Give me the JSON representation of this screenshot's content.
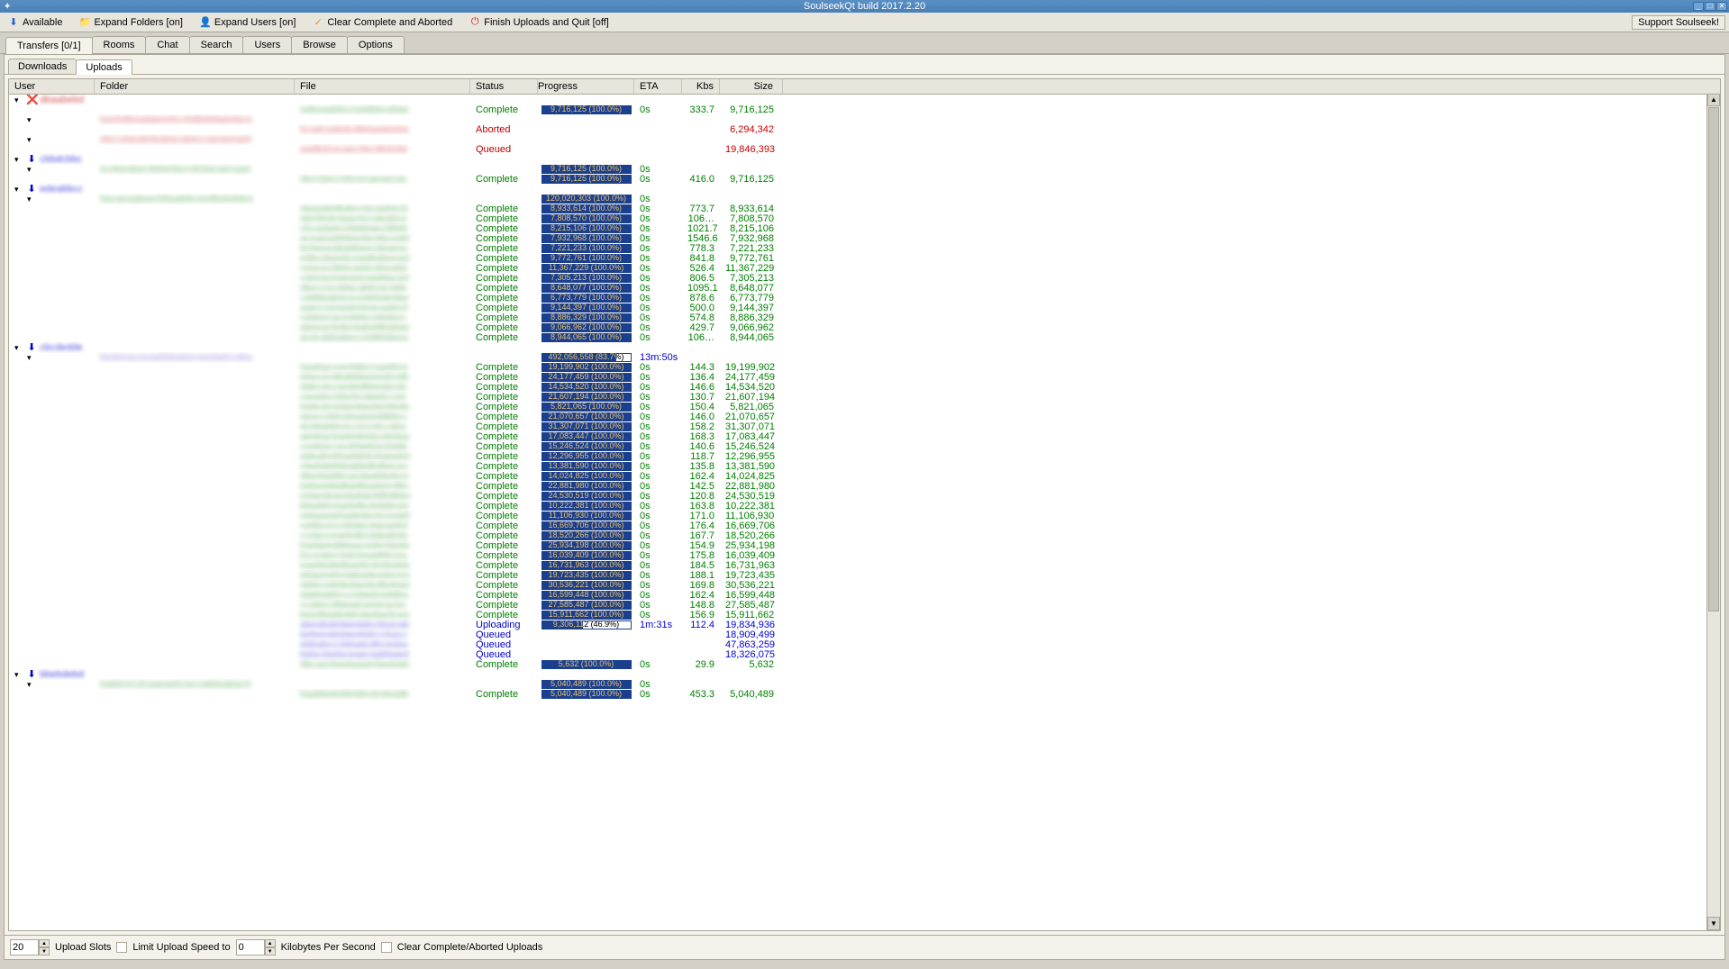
{
  "titlebar": {
    "title": "SoulseekQt build 2017.2.20"
  },
  "toolbar": {
    "available": "Available",
    "expand_folders": "Expand Folders [on]",
    "expand_users": "Expand Users [on]",
    "clear": "Clear Complete and Aborted",
    "finish": "Finish Uploads and Quit [off]",
    "support": "Support Soulseek!"
  },
  "tabs": {
    "main": [
      "Transfers [0/1]",
      "Rooms",
      "Chat",
      "Search",
      "Users",
      "Browse",
      "Options"
    ],
    "sub": [
      "Downloads",
      "Uploads"
    ]
  },
  "headers": {
    "user": "User",
    "folder": "Folder",
    "file": "File",
    "status": "Status",
    "progress": "Progress",
    "eta": "ETA",
    "kbs": "Kbs",
    "size": "Size"
  },
  "status_labels": {
    "complete": "Complete",
    "aborted": "Aborted",
    "queued": "Queued",
    "uploading": "Uploading"
  },
  "rows": [
    {
      "t": "user",
      "usercls": "red",
      "icon": "❌"
    },
    {
      "t": "file",
      "status": "complete",
      "progress": "9,716,125 (100.0%)",
      "pct": 100,
      "eta": "0s",
      "kbs": "333.7",
      "size": "9,716,125",
      "cls": "green"
    },
    {
      "t": "folder",
      "cls": "red"
    },
    {
      "t": "file",
      "status": "aborted",
      "size": "6,294,342",
      "cls": "red"
    },
    {
      "t": "folder",
      "cls": "red"
    },
    {
      "t": "file",
      "status": "queued",
      "size": "19,846,393",
      "cls": "red"
    },
    {
      "t": "user",
      "usercls": "blue",
      "icon": "⬇"
    },
    {
      "t": "folder",
      "progress": "9,716,125 (100.0%)",
      "pct": 100,
      "eta": "0s",
      "cls": "green"
    },
    {
      "t": "file",
      "status": "complete",
      "progress": "9,716,125 (100.0%)",
      "pct": 100,
      "eta": "0s",
      "kbs": "416.0",
      "size": "9,716,125",
      "cls": "green"
    },
    {
      "t": "user",
      "usercls": "blue",
      "icon": "⬇"
    },
    {
      "t": "folder",
      "progress": "120,020,303 (100.0%)",
      "pct": 100,
      "eta": "0s",
      "cls": "green"
    },
    {
      "t": "file",
      "status": "complete",
      "progress": "8,933,614 (100.0%)",
      "pct": 100,
      "eta": "0s",
      "kbs": "773.7",
      "size": "8,933,614",
      "cls": "green"
    },
    {
      "t": "file",
      "status": "complete",
      "progress": "7,808,570 (100.0%)",
      "pct": 100,
      "eta": "0s",
      "kbs": "106…",
      "size": "7,808,570",
      "cls": "green"
    },
    {
      "t": "file",
      "status": "complete",
      "progress": "8,215,106 (100.0%)",
      "pct": 100,
      "eta": "0s",
      "kbs": "1021.7",
      "size": "8,215,106",
      "cls": "green"
    },
    {
      "t": "file",
      "status": "complete",
      "progress": "7,932,968 (100.0%)",
      "pct": 100,
      "eta": "0s",
      "kbs": "1546.6",
      "size": "7,932,968",
      "cls": "green"
    },
    {
      "t": "file",
      "status": "complete",
      "progress": "7,221,233 (100.0%)",
      "pct": 100,
      "eta": "0s",
      "kbs": "778.3",
      "size": "7,221,233",
      "cls": "green"
    },
    {
      "t": "file",
      "status": "complete",
      "progress": "9,772,761 (100.0%)",
      "pct": 100,
      "eta": "0s",
      "kbs": "841.8",
      "size": "9,772,761",
      "cls": "green"
    },
    {
      "t": "file",
      "status": "complete",
      "progress": "11,367,229 (100.0%)",
      "pct": 100,
      "eta": "0s",
      "kbs": "526.4",
      "size": "11,367,229",
      "cls": "green"
    },
    {
      "t": "file",
      "status": "complete",
      "progress": "7,305,213 (100.0%)",
      "pct": 100,
      "eta": "0s",
      "kbs": "806.5",
      "size": "7,305,213",
      "cls": "green"
    },
    {
      "t": "file",
      "status": "complete",
      "progress": "8,648,077 (100.0%)",
      "pct": 100,
      "eta": "0s",
      "kbs": "1095.1",
      "size": "8,648,077",
      "cls": "green"
    },
    {
      "t": "file",
      "status": "complete",
      "progress": "6,773,779 (100.0%)",
      "pct": 100,
      "eta": "0s",
      "kbs": "878.6",
      "size": "6,773,779",
      "cls": "green"
    },
    {
      "t": "file",
      "status": "complete",
      "progress": "9,144,397 (100.0%)",
      "pct": 100,
      "eta": "0s",
      "kbs": "500.0",
      "size": "9,144,397",
      "cls": "green"
    },
    {
      "t": "file",
      "status": "complete",
      "progress": "8,886,329 (100.0%)",
      "pct": 100,
      "eta": "0s",
      "kbs": "574.8",
      "size": "8,886,329",
      "cls": "green"
    },
    {
      "t": "file",
      "status": "complete",
      "progress": "9,066,962 (100.0%)",
      "pct": 100,
      "eta": "0s",
      "kbs": "429.7",
      "size": "9,066,962",
      "cls": "green"
    },
    {
      "t": "file",
      "status": "complete",
      "progress": "8,944,065 (100.0%)",
      "pct": 100,
      "eta": "0s",
      "kbs": "106…",
      "size": "8,944,065",
      "cls": "green"
    },
    {
      "t": "user",
      "usercls": "blue",
      "icon": "⬇"
    },
    {
      "t": "folder",
      "progress": "492,056,558 (83.7%)",
      "pct": 83.7,
      "eta": "13m:50s",
      "cls": "blue",
      "foldercls": "purple"
    },
    {
      "t": "file",
      "status": "complete",
      "progress": "19,199,902 (100.0%)",
      "pct": 100,
      "eta": "0s",
      "kbs": "144.3",
      "size": "19,199,902",
      "cls": "green"
    },
    {
      "t": "file",
      "status": "complete",
      "progress": "24,177,459 (100.0%)",
      "pct": 100,
      "eta": "0s",
      "kbs": "136.4",
      "size": "24,177,459",
      "cls": "green"
    },
    {
      "t": "file",
      "status": "complete",
      "progress": "14,534,520 (100.0%)",
      "pct": 100,
      "eta": "0s",
      "kbs": "146.6",
      "size": "14,534,520",
      "cls": "green"
    },
    {
      "t": "file",
      "status": "complete",
      "progress": "21,607,194 (100.0%)",
      "pct": 100,
      "eta": "0s",
      "kbs": "130.7",
      "size": "21,607,194",
      "cls": "green"
    },
    {
      "t": "file",
      "status": "complete",
      "progress": "5,821,065 (100.0%)",
      "pct": 100,
      "eta": "0s",
      "kbs": "150.4",
      "size": "5,821,065",
      "cls": "green"
    },
    {
      "t": "file",
      "status": "complete",
      "progress": "21,070,657 (100.0%)",
      "pct": 100,
      "eta": "0s",
      "kbs": "146.0",
      "size": "21,070,657",
      "cls": "green"
    },
    {
      "t": "file",
      "status": "complete",
      "progress": "31,307,071 (100.0%)",
      "pct": 100,
      "eta": "0s",
      "kbs": "158.2",
      "size": "31,307,071",
      "cls": "green"
    },
    {
      "t": "file",
      "status": "complete",
      "progress": "17,083,447 (100.0%)",
      "pct": 100,
      "eta": "0s",
      "kbs": "168.3",
      "size": "17,083,447",
      "cls": "green"
    },
    {
      "t": "file",
      "status": "complete",
      "progress": "15,246,524 (100.0%)",
      "pct": 100,
      "eta": "0s",
      "kbs": "140.6",
      "size": "15,246,524",
      "cls": "green"
    },
    {
      "t": "file",
      "status": "complete",
      "progress": "12,296,955 (100.0%)",
      "pct": 100,
      "eta": "0s",
      "kbs": "118.7",
      "size": "12,296,955",
      "cls": "green"
    },
    {
      "t": "file",
      "status": "complete",
      "progress": "13,381,590 (100.0%)",
      "pct": 100,
      "eta": "0s",
      "kbs": "135.8",
      "size": "13,381,590",
      "cls": "green"
    },
    {
      "t": "file",
      "status": "complete",
      "progress": "14,024,825 (100.0%)",
      "pct": 100,
      "eta": "0s",
      "kbs": "162.4",
      "size": "14,024,825",
      "cls": "green"
    },
    {
      "t": "file",
      "status": "complete",
      "progress": "22,881,980 (100.0%)",
      "pct": 100,
      "eta": "0s",
      "kbs": "142.5",
      "size": "22,881,980",
      "cls": "green"
    },
    {
      "t": "file",
      "status": "complete",
      "progress": "24,530,519 (100.0%)",
      "pct": 100,
      "eta": "0s",
      "kbs": "120.8",
      "size": "24,530,519",
      "cls": "green"
    },
    {
      "t": "file",
      "status": "complete",
      "progress": "10,222,381 (100.0%)",
      "pct": 100,
      "eta": "0s",
      "kbs": "163.8",
      "size": "10,222,381",
      "cls": "green"
    },
    {
      "t": "file",
      "status": "complete",
      "progress": "11,106,930 (100.0%)",
      "pct": 100,
      "eta": "0s",
      "kbs": "171.0",
      "size": "11,106,930",
      "cls": "green"
    },
    {
      "t": "file",
      "status": "complete",
      "progress": "16,669,706 (100.0%)",
      "pct": 100,
      "eta": "0s",
      "kbs": "176.4",
      "size": "16,669,706",
      "cls": "green"
    },
    {
      "t": "file",
      "status": "complete",
      "progress": "18,520,266 (100.0%)",
      "pct": 100,
      "eta": "0s",
      "kbs": "167.7",
      "size": "18,520,266",
      "cls": "green"
    },
    {
      "t": "file",
      "status": "complete",
      "progress": "25,934,198 (100.0%)",
      "pct": 100,
      "eta": "0s",
      "kbs": "154.9",
      "size": "25,934,198",
      "cls": "green"
    },
    {
      "t": "file",
      "status": "complete",
      "progress": "16,039,409 (100.0%)",
      "pct": 100,
      "eta": "0s",
      "kbs": "175.8",
      "size": "16,039,409",
      "cls": "green"
    },
    {
      "t": "file",
      "status": "complete",
      "progress": "16,731,963 (100.0%)",
      "pct": 100,
      "eta": "0s",
      "kbs": "184.5",
      "size": "16,731,963",
      "cls": "green"
    },
    {
      "t": "file",
      "status": "complete",
      "progress": "19,723,435 (100.0%)",
      "pct": 100,
      "eta": "0s",
      "kbs": "188.1",
      "size": "19,723,435",
      "cls": "green"
    },
    {
      "t": "file",
      "status": "complete",
      "progress": "30,536,221 (100.0%)",
      "pct": 100,
      "eta": "0s",
      "kbs": "169.8",
      "size": "30,536,221",
      "cls": "green"
    },
    {
      "t": "file",
      "status": "complete",
      "progress": "16,599,448 (100.0%)",
      "pct": 100,
      "eta": "0s",
      "kbs": "162.4",
      "size": "16,599,448",
      "cls": "green"
    },
    {
      "t": "file",
      "status": "complete",
      "progress": "27,585,487 (100.0%)",
      "pct": 100,
      "eta": "0s",
      "kbs": "148.8",
      "size": "27,585,487",
      "cls": "green"
    },
    {
      "t": "file",
      "status": "complete",
      "progress": "15,911,662 (100.0%)",
      "pct": 100,
      "eta": "0s",
      "kbs": "156.9",
      "size": "15,911,662",
      "cls": "green"
    },
    {
      "t": "file",
      "status": "uploading",
      "progress": "9,306,112 (46.9%)",
      "pct": 46.9,
      "eta": "1m:31s",
      "kbs": "112.4",
      "size": "19,834,936",
      "cls": "blue"
    },
    {
      "t": "file",
      "status": "queued",
      "size": "18,909,499",
      "cls": "blue"
    },
    {
      "t": "file",
      "status": "queued",
      "size": "47,863,259",
      "cls": "blue"
    },
    {
      "t": "file",
      "status": "queued",
      "size": "18,326,075",
      "cls": "blue"
    },
    {
      "t": "file",
      "status": "complete",
      "progress": "5,632 (100.0%)",
      "pct": 100,
      "eta": "0s",
      "kbs": "29.9",
      "size": "5,632",
      "cls": "green"
    },
    {
      "t": "user",
      "usercls": "blue",
      "icon": "⬇"
    },
    {
      "t": "folder",
      "progress": "5,040,489 (100.0%)",
      "pct": 100,
      "eta": "0s",
      "cls": "green"
    },
    {
      "t": "file",
      "status": "complete",
      "progress": "5,040,489 (100.0%)",
      "pct": 100,
      "eta": "0s",
      "kbs": "453.3",
      "size": "5,040,489",
      "cls": "green"
    }
  ],
  "bottom": {
    "upload_slots_val": "20",
    "upload_slots_label": "Upload Slots",
    "limit_label": "Limit Upload Speed to",
    "limit_val": "0",
    "kps_label": "Kilobytes Per Second",
    "clear_label": "Clear Complete/Aborted Uploads"
  }
}
